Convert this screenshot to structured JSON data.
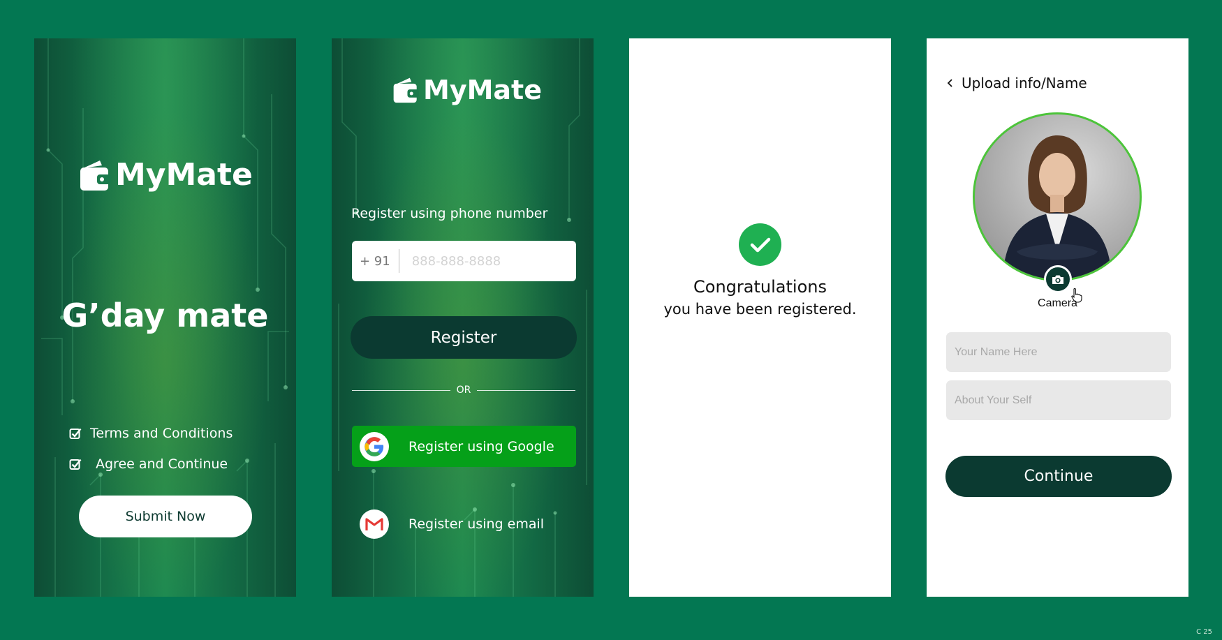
{
  "colors": {
    "page_background": "#037752",
    "dark_button": "#0b3a31",
    "google_button": "#05a019",
    "success": "#1fb052",
    "avatar_ring": "#4cc43a",
    "field_background": "#e8e8e8"
  },
  "icons": {
    "logo": "wallet-icon",
    "checkbox": "checkbox-checked-icon",
    "google": "google-icon",
    "gmail": "gmail-icon",
    "success": "checkmark-icon",
    "back": "chevron-left-icon",
    "camera": "camera-icon",
    "cursor": "hand-pointer-icon"
  },
  "welcome": {
    "brand": "MyMate",
    "greeting": "G’day mate",
    "checks": [
      {
        "label": "Terms and Conditions",
        "checked": true
      },
      {
        "label": "Agree and Continue",
        "checked": true
      }
    ],
    "submit_label": "Submit Now"
  },
  "register": {
    "brand": "MyMate",
    "phone_label": "Register using phone number",
    "country_code": "+ 91",
    "phone_placeholder": "888-888-8888",
    "register_label": "Register",
    "or_label": "OR",
    "google_label": "Register using Google",
    "email_label": "Register using email"
  },
  "success": {
    "title": "Congratulations",
    "message": "you have been registered."
  },
  "profile": {
    "back_label": "Upload info/Name",
    "camera_label": "Camera",
    "name_placeholder": "Your Name Here",
    "about_placeholder": "About Your Self",
    "continue_label": "Continue"
  },
  "corner_mark": "C 25"
}
